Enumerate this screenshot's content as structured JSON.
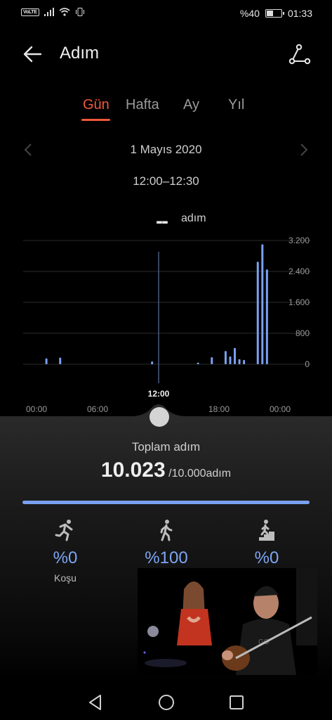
{
  "status_bar": {
    "volte": "VoLTE",
    "battery_text": "%40",
    "time": "01:33",
    "battery_level": 0.4
  },
  "header": {
    "title": "Adım",
    "back_icon": "arrow-left-icon",
    "share_icon": "share-icon"
  },
  "tabs": [
    {
      "label": "Gün",
      "active": true
    },
    {
      "label": "Hafta",
      "active": false
    },
    {
      "label": "Ay",
      "active": false
    },
    {
      "label": "Yıl",
      "active": false
    }
  ],
  "date": "1 Mayıs 2020",
  "time_range": "12:00–12:30",
  "selected_value": "--",
  "selected_unit": "adım",
  "chart_data": {
    "type": "bar",
    "y_ticks": [
      "3.200",
      "2.400",
      "1.600",
      "800",
      "0"
    ],
    "x_ticks": [
      "00:00",
      "06:00",
      "12:00",
      "18:00",
      "00:00"
    ],
    "selected_tick": "12:00",
    "ylim": [
      0,
      3200
    ],
    "grid": true,
    "bars": [
      {
        "t": 1.0,
        "v": 150
      },
      {
        "t": 2.5,
        "v": 170
      },
      {
        "t": 12.5,
        "v": 70
      },
      {
        "t": 17.5,
        "v": 40
      },
      {
        "t": 19.0,
        "v": 180
      },
      {
        "t": 20.5,
        "v": 340
      },
      {
        "t": 21.0,
        "v": 200
      },
      {
        "t": 21.5,
        "v": 420
      },
      {
        "t": 22.0,
        "v": 130
      },
      {
        "t": 22.5,
        "v": 110
      },
      {
        "t": 24.0,
        "v": 2650
      },
      {
        "t": 24.5,
        "v": 3100
      },
      {
        "t": 25.0,
        "v": 2450
      }
    ]
  },
  "summary": {
    "label": "Toplam adım",
    "value": "10.023",
    "goal": "/10.000adım",
    "progress": 1.0
  },
  "activities": [
    {
      "icon": "running-icon",
      "percent": "%0",
      "label": "Koşu"
    },
    {
      "icon": "walking-icon",
      "percent": "%100",
      "label": ""
    },
    {
      "icon": "stairs-icon",
      "percent": "%0",
      "label": ""
    }
  ],
  "colors": {
    "accent": "#f2573a",
    "bar": "#7aa1f0",
    "percent": "#7ea6f4"
  },
  "nav": {
    "back_icon": "nav-back-icon",
    "home_icon": "nav-home-icon",
    "recents_icon": "nav-recents-icon"
  }
}
